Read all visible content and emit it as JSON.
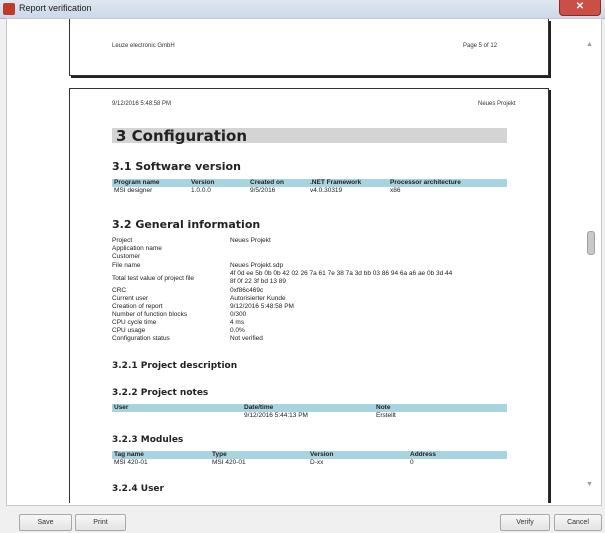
{
  "window": {
    "title": "Report verification",
    "close_glyph": "✕"
  },
  "page_prev": {
    "footer_left": "Leuze electronic GmbH",
    "footer_right": "Page 5 of 12"
  },
  "page": {
    "header_left": "9/12/2016 5:48:58 PM",
    "header_right": "Neues Projekt",
    "heading": "3 Configuration",
    "software": {
      "heading": "3.1 Software version",
      "headers": [
        "Program name",
        "Version",
        "Created on",
        ".NET Framework",
        "Processor architecture"
      ],
      "row": [
        "MSI designer",
        "1.0.0.0",
        "9/5/2016",
        "v4.0.30319",
        "x86"
      ]
    },
    "general": {
      "heading": "3.2 General information",
      "items": [
        {
          "label": "Project",
          "value": "Neues Projekt"
        },
        {
          "label": "Application name",
          "value": ""
        },
        {
          "label": "Customer",
          "value": ""
        },
        {
          "label": "File name",
          "value": "Neues Projekt.sdp"
        },
        {
          "label": "Total test value of project file",
          "value": "4f 0d ee 5b 0b 0b 42 02 26 7a 61 7e 38 7a 3d bb 03 86 94 6a a6 ae 0b 3d 44",
          "value2": "8f 0f 22 3f bd 13 89"
        },
        {
          "label": "CRC",
          "value": "0xf86c469c"
        },
        {
          "label": "Current user",
          "value": "Autorisierter Kunde"
        },
        {
          "label": "Creation of report",
          "value": "9/12/2016 5:48:58 PM"
        },
        {
          "label": "Number of function blocks",
          "value": "0/300"
        },
        {
          "label": "CPU cycle time",
          "value": "4 ms"
        },
        {
          "label": "CPU usage",
          "value": "0.0%"
        },
        {
          "label": "Configuration status",
          "value": "Not verified"
        }
      ]
    },
    "desc_heading": "3.2.1 Project description",
    "notes": {
      "heading": "3.2.2 Project notes",
      "headers": [
        "User",
        "Date/time",
        "Note"
      ],
      "row": [
        "",
        "9/12/2016 5:44:13 PM",
        "Erstellt"
      ]
    },
    "modules": {
      "heading": "3.2.3 Modules",
      "headers": [
        "Tag name",
        "Type",
        "Version",
        "Address"
      ],
      "row": [
        "MSI 420-01",
        "MSI 420-01",
        "D-xx",
        "0"
      ]
    },
    "user_heading": "3.2.4 User"
  },
  "scrollbar": {
    "up": "▲",
    "down": "▼"
  },
  "buttons": {
    "save": "Save",
    "print": "Print",
    "verify": "Verify",
    "cancel": "Cancel"
  },
  "colors": {
    "table_header": "#a7d4e0",
    "heading_bar": "#d4d4d4",
    "close": "#c94f47"
  }
}
